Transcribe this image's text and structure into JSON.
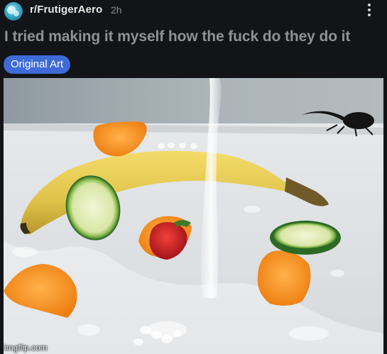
{
  "post": {
    "subreddit": "r/FrutigerAero",
    "time": "2h",
    "title": "I tried making it myself how the fuck do they do it",
    "flair": "Original Art"
  },
  "media": {
    "watermark": "imgflip.com"
  },
  "colors": {
    "background": "#131417",
    "flair": "#3e6bd6",
    "title": "#8e9195"
  },
  "icons": {
    "overflow": "vertical-ellipsis-icon",
    "avatar": "subreddit-avatar"
  }
}
